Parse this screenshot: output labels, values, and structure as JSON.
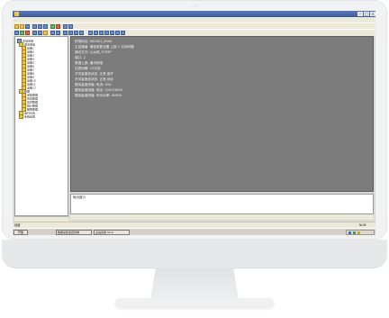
{
  "window": {
    "title": ""
  },
  "menu": {
    "items": [
      "文件(F)",
      "编辑(E)",
      "查看(V)",
      "通讯(C)",
      "系统(S)",
      "帮助(H)"
    ]
  },
  "tree": {
    "items": [
      {
        "label": "主站系统",
        "icon": "computer-icon"
      },
      {
        "label": "通讯通道",
        "icon": "folder-icon"
      },
      {
        "label": "设备1",
        "icon": "folder-icon"
      },
      {
        "label": "设备2",
        "icon": "folder-icon"
      },
      {
        "label": "设备3",
        "icon": "folder-icon"
      },
      {
        "label": "设备4",
        "icon": "folder-icon"
      },
      {
        "label": "设备5",
        "icon": "folder-icon"
      },
      {
        "label": "设备6",
        "icon": "folder-icon"
      },
      {
        "label": "设备7",
        "icon": "folder-icon"
      },
      {
        "label": "设备8",
        "icon": "folder-icon"
      },
      {
        "label": "设备9",
        "icon": "folder-icon"
      },
      {
        "label": "设备10",
        "icon": "folder-icon"
      },
      {
        "label": "设备11",
        "icon": "folder-icon"
      },
      {
        "label": "设备12",
        "icon": "folder-icon"
      },
      {
        "label": "数据",
        "icon": "folder-icon"
      },
      {
        "label": "采集数据",
        "icon": "folder-icon"
      },
      {
        "label": "历史数据",
        "icon": "folder-icon"
      },
      {
        "label": "实时数据",
        "icon": "folder-icon"
      },
      {
        "label": "统计数据",
        "icon": "folder-icon"
      },
      {
        "label": "报警数据",
        "icon": "folder-icon"
      },
      {
        "label": "运行日志",
        "icon": "folder-icon"
      },
      {
        "label": "系统设置",
        "icon": "folder-icon"
      }
    ]
  },
  "main": {
    "lines": [
      "终端地址: 000001_0000",
      "主站通道: 通信参数设置 上报 1 分钟间隔",
      "通讯方式: 以太网_TCP/IP",
      "端口: 2",
      "数据上报: 通讯终端",
      "抄表间隔: 15分钟",
      "开关量遥信状态: 正常 断开",
      "开关量遥信状态: 正常 闭合",
      "模拟量遥测值: 电流: 40A",
      "模拟量遥测值: 电压: 220V/380V",
      "模拟量遥测值: 有功功率: 4kW/h"
    ]
  },
  "output": {
    "label": "输出窗口"
  },
  "output_tabs": [
    "系统信息",
    "通讯报文",
    "错误信息"
  ],
  "left_tabs": [
    "设备",
    "数据"
  ],
  "status": {
    "left": "就绪",
    "right": "NUM"
  },
  "taskbar": {
    "start": "开始",
    "tasks": [
      "数据采集监控终端",
      "主站系统 V2.0"
    ]
  }
}
